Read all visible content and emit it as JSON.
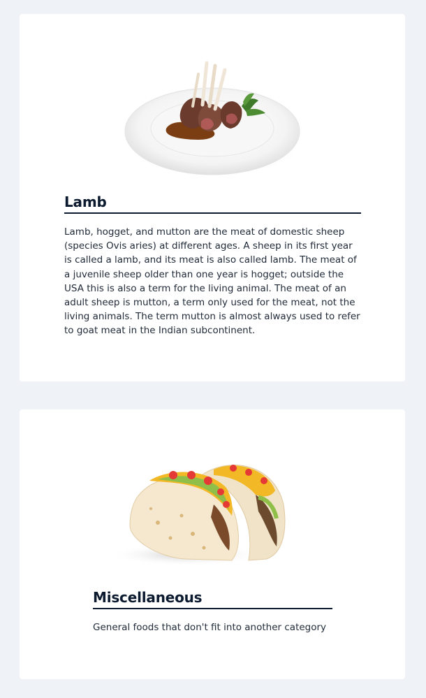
{
  "cards": [
    {
      "title": "Lamb",
      "description": "Lamb, hogget, and mutton are the meat of domestic sheep (species Ovis aries) at different ages. A sheep in its first year is called a lamb, and its meat is also called lamb. The meat of a juvenile sheep older than one year is hogget; outside the USA this is also a term for the living animal. The meat of an adult sheep is mutton, a term only used for the meat, not the living animals. The term mutton is almost always used to refer to goat meat in the Indian subcontinent.",
      "image": "lamb-chops-plate-image"
    },
    {
      "title": "Miscellaneous",
      "description": "General foods that don't fit into another category",
      "image": "tacos-image"
    }
  ],
  "colors": {
    "page_background": "#eff2f7",
    "card_background": "#ffffff",
    "title_color": "#0b1a2e",
    "text_color": "#1f2937"
  }
}
